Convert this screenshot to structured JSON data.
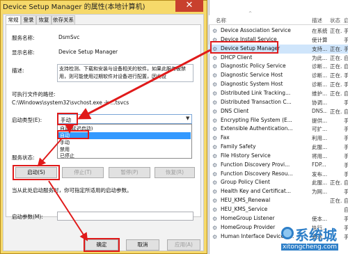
{
  "dialog": {
    "title": "Device Setup Manager 的属性(本地计算机)",
    "close_glyph": "✕",
    "tabs": [
      {
        "label": "常规"
      },
      {
        "label": "登录"
      },
      {
        "label": "恢复"
      },
      {
        "label": "依存关系"
      }
    ],
    "service_name_label": "服务名称:",
    "service_name_value": "DsmSvc",
    "display_name_label": "显示名称:",
    "display_name_value": "Device Setup Manager",
    "description_label": "描述:",
    "description_value": "支持检测、下载和安装与设备相关的软件。如果此服务被禁用，则可能使用过期软件对设备进行配置，因此设",
    "exe_path_label": "可执行文件的路径:",
    "exe_path_value": "C:\\Windows\\system32\\svchost.exe -k ...tsvcs",
    "startup_type_label": "启动类型(E):",
    "startup_type_value": "手动",
    "startup_options": [
      {
        "label": "自动(延迟启动)"
      },
      {
        "label": "自动"
      },
      {
        "label": "手动"
      },
      {
        "label": "禁用"
      },
      {
        "label": "已停止"
      }
    ],
    "service_status_label": "服务状态:",
    "buttons": {
      "start": "启动(S)",
      "stop": "停止(T)",
      "pause": "暂停(P)",
      "resume": "恢复(R)"
    },
    "start_hint": "当从此处启动服务时，你可指定所适用的启动参数。",
    "start_params_label": "启动参数(M):",
    "footer": {
      "ok": "确定",
      "cancel": "取消",
      "apply": "应用(A)"
    }
  },
  "services": {
    "columns": {
      "name": "名称",
      "description": "描述",
      "status": "状态",
      "startup": "启"
    },
    "sort_indicator": "^",
    "rows": [
      {
        "name": "Device Association Service",
        "desc": "在系统...",
        "status": "正在...",
        "start": "手"
      },
      {
        "name": "Device Install Service",
        "desc": "使计算...",
        "status": "",
        "start": "手"
      },
      {
        "name": "Device Setup Manager",
        "desc": "支持...",
        "status": "正在...",
        "start": "手"
      },
      {
        "name": "DHCP Client",
        "desc": "为此...",
        "status": "正在...",
        "start": "自"
      },
      {
        "name": "Diagnostic Policy Service",
        "desc": "诊断...",
        "status": "正在...",
        "start": "自"
      },
      {
        "name": "Diagnostic Service Host",
        "desc": "诊断...",
        "status": "正在...",
        "start": "手"
      },
      {
        "name": "Diagnostic System Host",
        "desc": "诊断...",
        "status": "正在...",
        "start": "手"
      },
      {
        "name": "Distributed Link Tracking...",
        "desc": "维护...",
        "status": "正在...",
        "start": "自"
      },
      {
        "name": "Distributed Transaction C...",
        "desc": "协调...",
        "status": "",
        "start": "手"
      },
      {
        "name": "DNS Client",
        "desc": "DNS...",
        "status": "正在...",
        "start": "自"
      },
      {
        "name": "Encrypting File System (E...",
        "desc": "提供...",
        "status": "",
        "start": "手"
      },
      {
        "name": "Extensible Authentication...",
        "desc": "可扩...",
        "status": "",
        "start": "手"
      },
      {
        "name": "Fax",
        "desc": "利用...",
        "status": "",
        "start": "手"
      },
      {
        "name": "Family Safety",
        "desc": "此服...",
        "status": "",
        "start": "手"
      },
      {
        "name": "File History Service",
        "desc": "将用...",
        "status": "",
        "start": "手"
      },
      {
        "name": "Function Discovery Provi...",
        "desc": "FDP...",
        "status": "",
        "start": "手"
      },
      {
        "name": "Function Discovery Resou...",
        "desc": "发布...",
        "status": "",
        "start": "手"
      },
      {
        "name": "Group Policy Client",
        "desc": "此服...",
        "status": "正在...",
        "start": "自"
      },
      {
        "name": "Health Key and Certificat...",
        "desc": "为网...",
        "status": "",
        "start": "手"
      },
      {
        "name": "HEU_KMS_Renewal",
        "desc": "",
        "status": "正在...",
        "start": "自"
      },
      {
        "name": "HEU_KMS_Service",
        "desc": "",
        "status": "",
        "start": "自"
      },
      {
        "name": "HomeGroup Listener",
        "desc": "使本...",
        "status": "",
        "start": "手"
      },
      {
        "name": "HomeGroup Provider",
        "desc": "执行...",
        "status": "",
        "start": "手"
      },
      {
        "name": "Human Interface Device S...",
        "desc": "激活...",
        "status": "",
        "start": "手"
      }
    ]
  },
  "watermark": {
    "brand": "系统城",
    "url": "xitongcheng.com"
  },
  "colors": {
    "title_bar": "#f6d96a",
    "highlight_box": "#e01a1a",
    "selection": "#3399ff",
    "watermark": "#2e7fc8"
  }
}
